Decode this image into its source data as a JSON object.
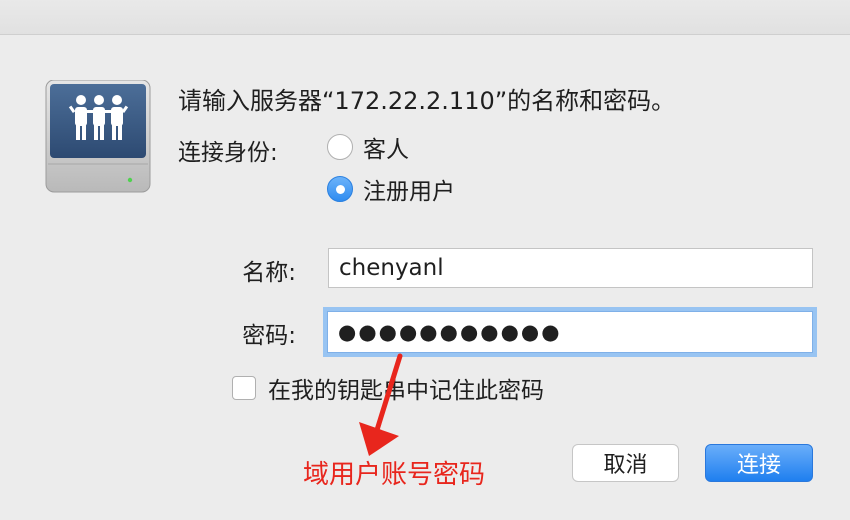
{
  "dialog": {
    "prompt": "请输入服务器“172.22.2.110”的名称和密码。",
    "identity_label": "连接身份:",
    "options": [
      {
        "label": "客人",
        "selected": false
      },
      {
        "label": "注册用户",
        "selected": true
      }
    ],
    "name_label": "名称:",
    "name_value": "chenyanl",
    "password_label": "密码:",
    "password_value": "●●●●●●●●●●●",
    "remember_label": "在我的钥匙串中记住此密码",
    "remember_checked": false,
    "cancel_label": "取消",
    "connect_label": "连接",
    "server_icon": "server-people-icon"
  },
  "annotation": {
    "text": "域用户账号密码",
    "color": "#e8261d"
  },
  "colors": {
    "accent": "#2f8cf0",
    "focus_ring": "#98c4f2"
  }
}
